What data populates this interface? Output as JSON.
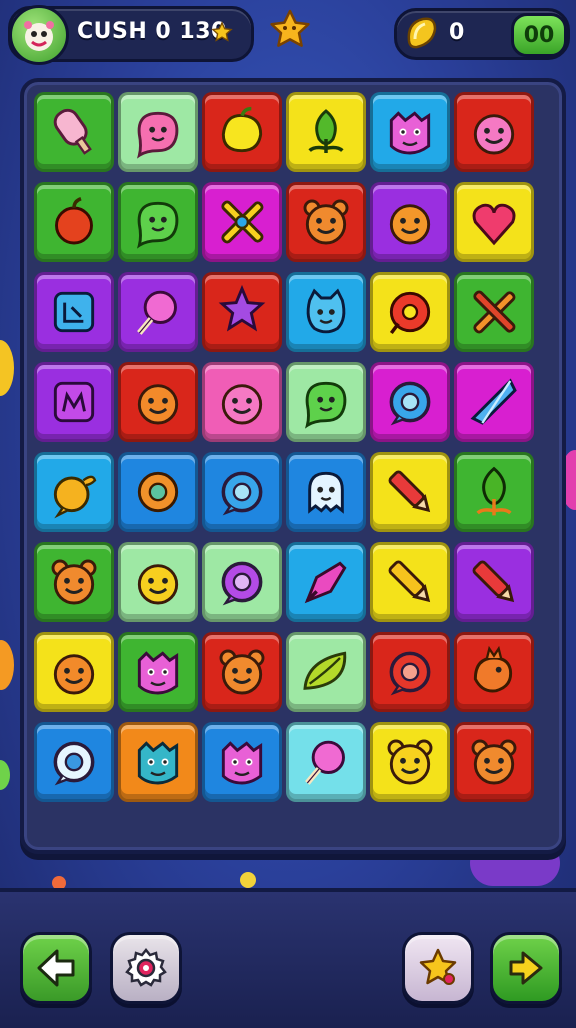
{
  "header": {
    "score_text": "CUSH 0 130",
    "coins_text": "0",
    "level_text": "00",
    "avatar_icon": "monster-face-icon",
    "center_icon": "star-icon",
    "coin_icon": "coin-icon"
  },
  "colors": {
    "green": "#3fb531",
    "mint": "#9ee8a4",
    "red": "#d9261b",
    "yellow": "#f4e21a",
    "sky": "#22a9e8",
    "magenta": "#d81fd0",
    "purple": "#9a2fe0",
    "pink": "#f05db6",
    "blue": "#1f86e0",
    "orange": "#f2891a",
    "cyan": "#74e0ea"
  },
  "board": {
    "rows": [
      [
        {
          "c": "green",
          "icon": "popsicle-icon"
        },
        {
          "c": "mint",
          "icon": "pink-blob-icon"
        },
        {
          "c": "red",
          "icon": "lemon-icon"
        },
        {
          "c": "yellow",
          "icon": "leaf-sprout-icon"
        },
        {
          "c": "sky",
          "icon": "pink-monster-icon"
        },
        {
          "c": "red",
          "icon": "pink-smiley-icon"
        }
      ],
      [
        {
          "c": "green",
          "icon": "apple-icon"
        },
        {
          "c": "green",
          "icon": "green-blob-icon"
        },
        {
          "c": "magenta",
          "icon": "crossed-bones-icon"
        },
        {
          "c": "red",
          "icon": "orange-bear-icon"
        },
        {
          "c": "purple",
          "icon": "orange-fruit-icon"
        },
        {
          "c": "yellow",
          "icon": "heart-icon"
        }
      ],
      [
        {
          "c": "purple",
          "icon": "blue-square-icon"
        },
        {
          "c": "purple",
          "icon": "lollipop-icon"
        },
        {
          "c": "red",
          "icon": "purple-star-icon"
        },
        {
          "c": "sky",
          "icon": "blue-cat-icon"
        },
        {
          "c": "yellow",
          "icon": "red-donut-icon"
        },
        {
          "c": "green",
          "icon": "crossed-tools-icon"
        }
      ],
      [
        {
          "c": "purple",
          "icon": "m-square-icon"
        },
        {
          "c": "red",
          "icon": "orange-smiley-icon"
        },
        {
          "c": "pink",
          "icon": "pink-smiley-icon"
        },
        {
          "c": "mint",
          "icon": "green-blob-icon"
        },
        {
          "c": "magenta",
          "icon": "blue-ring-icon"
        },
        {
          "c": "magenta",
          "icon": "blue-crystal-icon"
        }
      ],
      [
        {
          "c": "sky",
          "icon": "yellow-bird-icon"
        },
        {
          "c": "blue",
          "icon": "orange-donut-icon"
        },
        {
          "c": "blue",
          "icon": "blue-ring-icon"
        },
        {
          "c": "blue",
          "icon": "ghost-icon"
        },
        {
          "c": "yellow",
          "icon": "red-pencil-icon"
        },
        {
          "c": "green",
          "icon": "green-sprout-icon"
        }
      ],
      [
        {
          "c": "green",
          "icon": "orange-bear-icon"
        },
        {
          "c": "mint",
          "icon": "yellow-smiley-icon"
        },
        {
          "c": "mint",
          "icon": "purple-ring-icon"
        },
        {
          "c": "sky",
          "icon": "pink-cone-icon"
        },
        {
          "c": "yellow",
          "icon": "yellow-pencil-icon"
        },
        {
          "c": "purple",
          "icon": "red-pencil-icon"
        }
      ],
      [
        {
          "c": "yellow",
          "icon": "orange-smiley-icon"
        },
        {
          "c": "green",
          "icon": "pink-monster-icon"
        },
        {
          "c": "red",
          "icon": "orange-bear-icon"
        },
        {
          "c": "mint",
          "icon": "green-leaf-icon"
        },
        {
          "c": "red",
          "icon": "red-ring-icon"
        },
        {
          "c": "red",
          "icon": "orange-bird-icon"
        }
      ],
      [
        {
          "c": "blue",
          "icon": "white-ring-icon"
        },
        {
          "c": "orange",
          "icon": "teal-monster-icon"
        },
        {
          "c": "blue",
          "icon": "pink-monster-icon"
        },
        {
          "c": "cyan",
          "icon": "lollipop-icon"
        },
        {
          "c": "yellow",
          "icon": "yellow-bear-icon"
        },
        {
          "c": "red",
          "icon": "orange-bear-icon"
        }
      ]
    ]
  },
  "footer": {
    "back_icon": "back-arrow-icon",
    "settings_icon": "gear-icon",
    "booster_icon": "star-icon",
    "next_icon": "next-arrow-icon"
  }
}
